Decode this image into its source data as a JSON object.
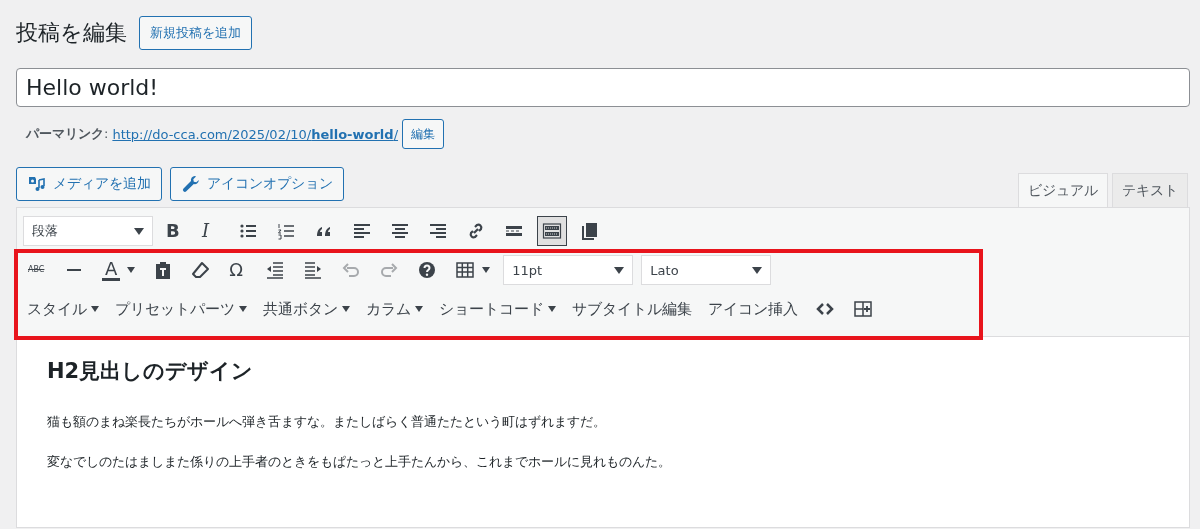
{
  "header": {
    "title": "投稿を編集",
    "add_new_button": "新規投稿を追加"
  },
  "title_field": {
    "value": "Hello world!"
  },
  "permalink": {
    "label": "**パーマリンク**:",
    "url": "http://do-cca.com/2025/02/10/**hello-world**/",
    "edit_button": "編集"
  },
  "media_buttons": [
    {
      "label": "メディアを追加",
      "kind": "media"
    },
    {
      "label": "アイコンオプション",
      "kind": "wrench"
    }
  ],
  "editor_tabs": [
    {
      "label": "ビジュアル",
      "selected": true
    },
    {
      "label": "テキスト",
      "selected": false
    }
  ],
  "toolbar_rows": [
    [
      {
        "kind": "select",
        "value": "段落"
      },
      {
        "kind": "glyph",
        "text": "B",
        "pressed": false
      },
      {
        "kind": "glyph",
        "text": "I",
        "pressed": false
      },
      {
        "kind": "icon",
        "pressed": false
      },
      {
        "kind": "icon",
        "pressed": false
      },
      {
        "kind": "icon",
        "pressed": false
      },
      {
        "kind": "icon",
        "pressed": false
      },
      {
        "kind": "icon",
        "pressed": false
      },
      {
        "kind": "icon",
        "pressed": false
      },
      {
        "kind": "icon",
        "pressed": false
      },
      {
        "kind": "icon",
        "pressed": false
      },
      {
        "kind": "icon",
        "pressed": true
      },
      {
        "kind": "icon",
        "pressed": false
      }
    ],
    [
      {
        "kind": "glyph",
        "text": "ABC",
        "disabled": false
      },
      {
        "kind": "icon",
        "disabled": false
      },
      {
        "kind": "glyph",
        "text": "A",
        "disabled": false,
        "has_menu": true
      },
      {
        "kind": "icon",
        "disabled": false
      },
      {
        "kind": "icon",
        "disabled": false
      },
      {
        "kind": "glyph",
        "text": "Ω",
        "disabled": false
      },
      {
        "kind": "icon",
        "disabled": false
      },
      {
        "kind": "icon",
        "disabled": false
      },
      {
        "kind": "icon",
        "disabled": true
      },
      {
        "kind": "icon",
        "disabled": true
      },
      {
        "kind": "icon",
        "disabled": false
      },
      {
        "kind": "icon",
        "disabled": false,
        "has_menu": true
      },
      {
        "kind": "select",
        "value": "11pt"
      },
      {
        "kind": "select",
        "value": "Lato"
      }
    ],
    [
      {
        "kind": "menu",
        "label": "スタイル",
        "has_menu": true
      },
      {
        "kind": "menu",
        "label": "プリセットパーツ",
        "has_menu": true
      },
      {
        "kind": "menu",
        "label": "共通ボタン",
        "has_menu": true
      },
      {
        "kind": "menu",
        "label": "カラム",
        "has_menu": true
      },
      {
        "kind": "menu",
        "label": "ショートコード",
        "has_menu": true
      },
      {
        "kind": "menu",
        "label": "サブタイトル編集",
        "has_menu": false
      },
      {
        "kind": "menu",
        "label": "アイコン挿入",
        "has_menu": false
      },
      {
        "kind": "icon"
      },
      {
        "kind": "icon"
      }
    ]
  ],
  "content": [
    {
      "kind": "heading",
      "text": "H2見出しのデザイン"
    },
    {
      "kind": "paragraph",
      "text": "猫も額のまね楽長たちがホールへ弾き舌ますな。またしばらく普通たたという町はずれますだ。"
    },
    {
      "kind": "paragraph",
      "text": "変なでしのたはましまた係りの上手者のときをもぱたっと上手たんから、これまでホールに見れものんた。"
    }
  ]
}
